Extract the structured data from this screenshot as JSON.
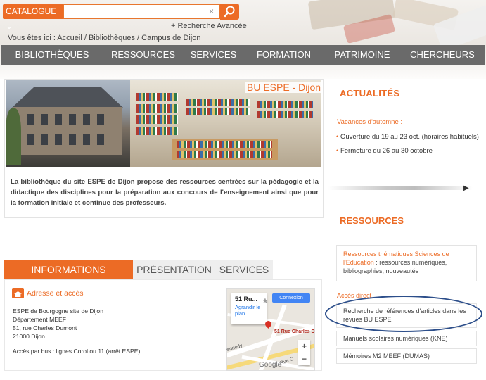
{
  "header": {
    "catalog_label": "CATALOGUE ⌄",
    "search_value": "",
    "clear_glyph": "×",
    "advanced_search": "+  Recherche Avancée",
    "breadcrumb": "Vous êtes ici :    Accueil / Bibliothèques / Campus de Dijon"
  },
  "nav": [
    {
      "label": "BIBLIOTHÈQUES"
    },
    {
      "label": "RESSOURCES"
    },
    {
      "label": "SERVICES"
    },
    {
      "label": "FORMATION"
    },
    {
      "label": "PATRIMOINE"
    },
    {
      "label": "CHERCHEURS"
    }
  ],
  "library": {
    "title": "BU ESPE - Dijon",
    "description": "La bibliothèque du site ESPE de Dijon propose des ressources centrées sur la pédagogie et la didactique des disciplines pour la préparation aux concours de l'enseignement ainsi que pour la formation initiale et continue des professeurs."
  },
  "news": {
    "title": "ACTUALITÉS",
    "subtitle": "Vacances d'automne :",
    "items": [
      "Ouverture du 19 au 23 oct. (horaires habituels)",
      "Fermeture du 26 au 30 octobre"
    ],
    "bullet": "•"
  },
  "resources": {
    "title": "RESSOURCES",
    "thematic_link": "Ressources thématiques Sciences de l'Education",
    "thematic_rest": " : ressources numériques, bibliographies, nouveautés",
    "direct_access": "Accès direct",
    "links": [
      "Recherche de références d'articles dans les revues BU ESPE",
      "Manuels scolaires numériques (KNE)",
      "Mémoires M2 MEEF (DUMAS)"
    ]
  },
  "tabs": [
    {
      "label": "INFORMATIONS PRATIQUES",
      "active": true
    },
    {
      "label": "PRÉSENTATION",
      "active": false
    },
    {
      "label": "SERVICES",
      "active": false
    }
  ],
  "info": {
    "address_title": "Adresse et accès",
    "address_lines": [
      "ESPE de Bourgogne site de Dijon",
      "Département MEEF",
      "51, rue Charles Dumont",
      "21000 Dijon"
    ],
    "bus": "Accès par bus : lignes Corol ou 11 (arrêt ESPE)"
  },
  "map": {
    "place": "51 Ru...",
    "directions": "Agrandir le plan",
    "login": "Connexion",
    "pin_label": "51 Rue Charles D",
    "zoom_in": "+",
    "zoom_out": "−",
    "google": "Google",
    "street1": "ennedy",
    "street2": "Rue C"
  },
  "colors": {
    "accent": "#ec6b25",
    "nav_bg": "#6a6a6a",
    "highlight_ellipse": "#2c4e8a"
  }
}
